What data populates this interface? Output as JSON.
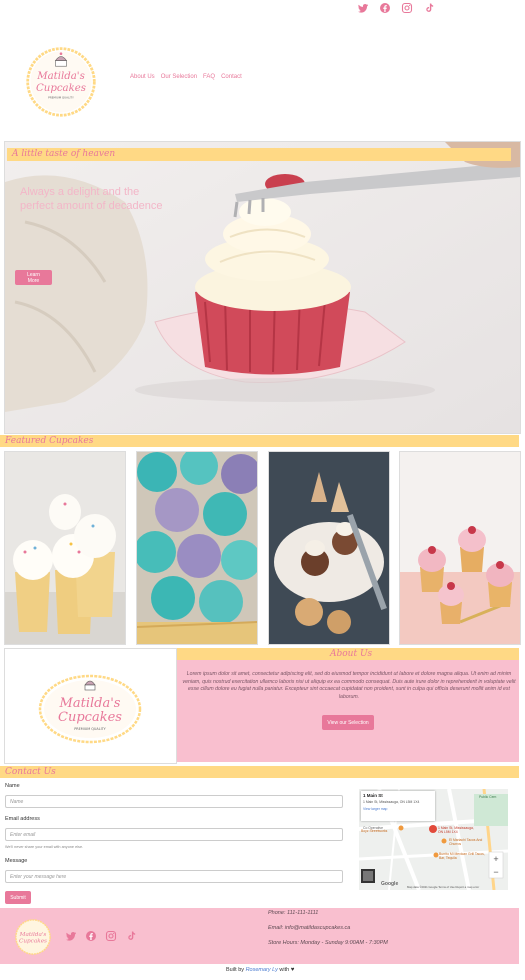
{
  "social": {
    "icons": [
      "twitter-icon",
      "facebook-icon",
      "instagram-icon",
      "tiktok-icon"
    ],
    "color": "#e8789a"
  },
  "logo": {
    "line1": "Matilda's",
    "line2": "Cupcakes",
    "tagline": "PREMIUM QUALITY"
  },
  "nav": {
    "items": [
      "About Us",
      "Our Selection",
      "FAQ",
      "Contact"
    ]
  },
  "hero": {
    "tagline": "A little taste of heaven",
    "headline": "Always a delight and the perfect amount of decadence",
    "button": "Learn More"
  },
  "featured": {
    "title": "Featured Cupcakes"
  },
  "about": {
    "title": "About Us",
    "text": "Lorem ipsum dolor sit amet, consectetur adipiscing elit, sed do eiusmod tempor incididunt ut labore et dolore magna aliqua. Ut enim ad minim veniam, quis nostrud exercitation ullamco laboris nisi ut aliquip ex ea commodo consequat. Duis aute irure dolor in reprehenderit in voluptate velit esse cillum dolore eu fugiat nulla pariatur. Excepteur sint occaecat cupidatat non proident, sunt in culpa qui officia deserunt mollit anim id est laborum.",
    "button": "View our Selection"
  },
  "contact": {
    "title": "Contact Us",
    "name_label": "Name",
    "name_placeholder": "Name",
    "email_label": "Email address",
    "email_placeholder": "Enter email",
    "email_hint": "We'll never share your email with anyone else.",
    "message_label": "Message",
    "message_placeholder": "Enter your message here",
    "submit": "Submit"
  },
  "map": {
    "place": "1 Main St",
    "address": "1 Main St, Mississauga, ON L5M 1X4",
    "larger_link": "View larger map",
    "pin_label": "1 Main St, Mississauga, ON L5M 1X4",
    "labels": {
      "operative": "Co Operative",
      "boys": "Boyz Streetworks",
      "mariachi": "El Mariachi Tacos And Churros",
      "burrito": "Burrito Mi Mexican Grill Tacos, Bar, Tequila",
      "public": "Public Cem"
    },
    "attribution": "Map data ©2021 Google  Terms of Use  Report a map error",
    "google": "Google"
  },
  "footer": {
    "phone": "Phone: 111-111-1111",
    "email": "Email: info@matildascupcakes.ca",
    "hours": "Store Hours: Monday - Sunday 9:00AM - 7:30PM"
  },
  "credit": {
    "prefix": "Built by",
    "name": "Rosemary Ly",
    "suffix": "with"
  }
}
